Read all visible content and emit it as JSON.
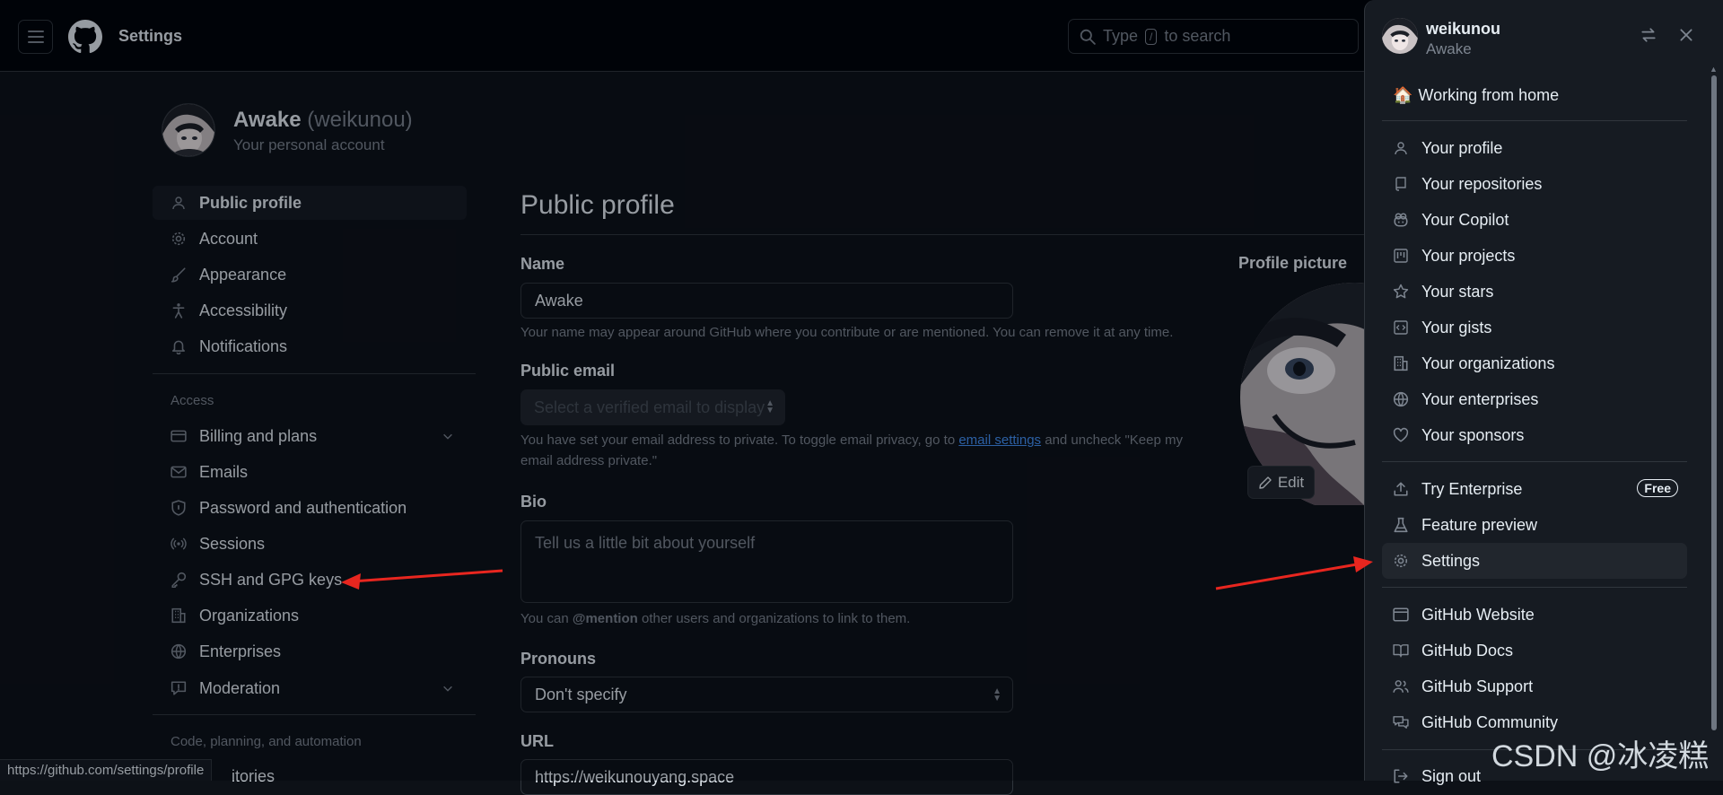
{
  "header": {
    "title": "Settings",
    "search_prefix": "Type",
    "search_key": "/",
    "search_suffix": "to search"
  },
  "account": {
    "name": "Awake",
    "handle": "(weikunou)",
    "subtitle": "Your personal account"
  },
  "sidebar": {
    "items": [
      {
        "label": "Public profile",
        "icon": "person-icon"
      },
      {
        "label": "Account",
        "icon": "gear-icon"
      },
      {
        "label": "Appearance",
        "icon": "paintbrush-icon"
      },
      {
        "label": "Accessibility",
        "icon": "accessibility-icon"
      },
      {
        "label": "Notifications",
        "icon": "bell-icon"
      }
    ],
    "access_heading": "Access",
    "access_items": [
      {
        "label": "Billing and plans",
        "icon": "credit-card-icon"
      },
      {
        "label": "Emails",
        "icon": "mail-icon"
      },
      {
        "label": "Password and authentication",
        "icon": "shield-lock-icon"
      },
      {
        "label": "Sessions",
        "icon": "broadcast-icon"
      },
      {
        "label": "SSH and GPG keys",
        "icon": "key-icon"
      },
      {
        "label": "Organizations",
        "icon": "organization-icon"
      },
      {
        "label": "Enterprises",
        "icon": "globe-icon"
      },
      {
        "label": "Moderation",
        "icon": "report-icon"
      }
    ],
    "code_heading": "Code, planning, and automation",
    "partial_item": "itories"
  },
  "main": {
    "title": "Public profile",
    "name_label": "Name",
    "name_value": "Awake",
    "name_note": "Your name may appear around GitHub where you contribute or are mentioned. You can remove it at any time.",
    "email_label": "Public email",
    "email_placeholder": "Select a verified email to display",
    "email_note_1": "You have set your email address to private. To toggle email privacy, go to",
    "email_note_link": "email settings",
    "email_note_2": "and uncheck \"Keep my",
    "email_note_3": "email address private.\"",
    "bio_label": "Bio",
    "bio_placeholder": "Tell us a little bit about yourself",
    "bio_note_1": "You can",
    "bio_note_mention": "@mention",
    "bio_note_2": "other users and organizations to link to them.",
    "pronouns_label": "Pronouns",
    "pronouns_value": "Don't specify",
    "url_label": "URL",
    "url_value": "https://weikunouyang.space",
    "profile_picture_label": "Profile picture",
    "edit_label": "Edit"
  },
  "status_url": "https://github.com/settings/profile",
  "panel": {
    "username": "weikunou",
    "display_name": "Awake",
    "status_emoji": "🏠",
    "status_text": "Working from home",
    "group1": [
      {
        "label": "Your profile",
        "icon": "person-icon"
      },
      {
        "label": "Your repositories",
        "icon": "repo-icon"
      },
      {
        "label": "Your Copilot",
        "icon": "copilot-icon"
      },
      {
        "label": "Your projects",
        "icon": "project-icon"
      },
      {
        "label": "Your stars",
        "icon": "star-icon"
      },
      {
        "label": "Your gists",
        "icon": "code-square-icon"
      },
      {
        "label": "Your organizations",
        "icon": "organization-icon"
      },
      {
        "label": "Your enterprises",
        "icon": "globe-icon"
      },
      {
        "label": "Your sponsors",
        "icon": "heart-icon"
      }
    ],
    "group2": [
      {
        "label": "Try Enterprise",
        "icon": "upload-icon",
        "badge": "Free"
      },
      {
        "label": "Feature preview",
        "icon": "beaker-icon"
      },
      {
        "label": "Settings",
        "icon": "gear-icon"
      }
    ],
    "group3": [
      {
        "label": "GitHub Website",
        "icon": "browser-icon"
      },
      {
        "label": "GitHub Docs",
        "icon": "book-icon"
      },
      {
        "label": "GitHub Support",
        "icon": "people-icon"
      },
      {
        "label": "GitHub Community",
        "icon": "comment-discussion-icon"
      }
    ],
    "sign_out": "Sign out"
  },
  "watermark": "CSDN @冰凌糕",
  "colors": {
    "accent": "#2f81f7",
    "arrow": "#e8261f",
    "background": "#0d1117",
    "panel": "#161b22"
  }
}
